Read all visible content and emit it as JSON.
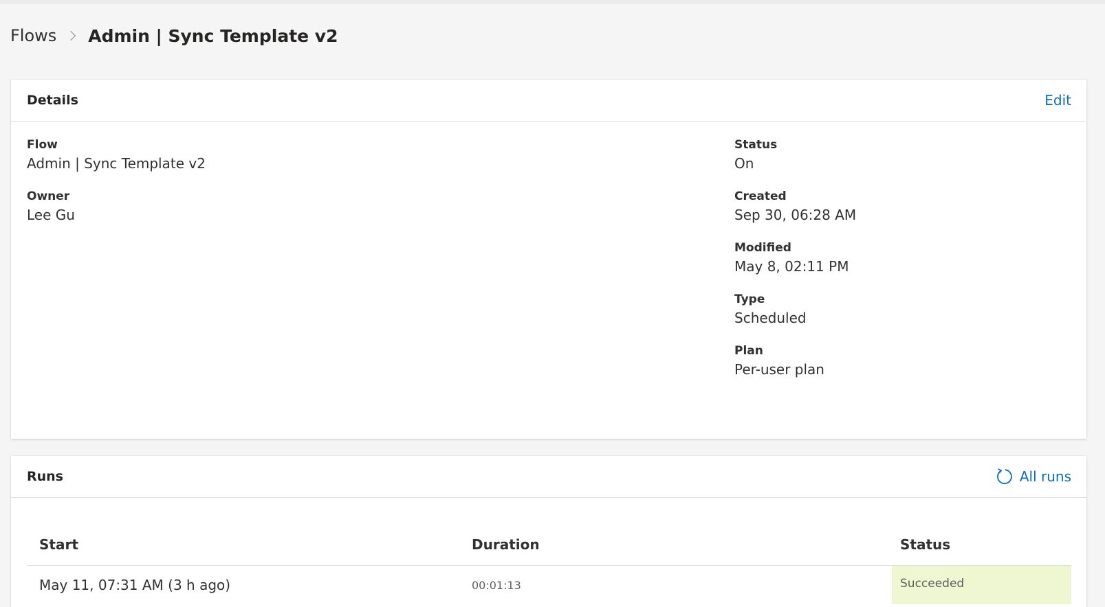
{
  "breadcrumb": {
    "root": "Flows",
    "current": "Admin | Sync Template v2"
  },
  "details": {
    "title": "Details",
    "edit_label": "Edit",
    "left_fields": [
      {
        "label": "Flow",
        "value": "Admin | Sync Template v2"
      },
      {
        "label": "Owner",
        "value": "Lee Gu"
      }
    ],
    "right_fields": [
      {
        "label": "Status",
        "value": "On"
      },
      {
        "label": "Created",
        "value": "Sep 30, 06:28 AM"
      },
      {
        "label": "Modified",
        "value": "May 8, 02:11 PM"
      },
      {
        "label": "Type",
        "value": "Scheduled"
      },
      {
        "label": "Plan",
        "value": "Per-user plan"
      }
    ]
  },
  "runs": {
    "title": "Runs",
    "all_runs_label": "All runs",
    "all_runs_icon": "refresh-icon",
    "columns": [
      "Start",
      "Duration",
      "Status"
    ],
    "rows": [
      {
        "start": "May 11, 07:31 AM (3 h ago)",
        "duration": "00:01:13",
        "status": "Succeeded"
      }
    ]
  },
  "colors": {
    "accent": "#0f6cbd",
    "succeeded_bg": "#eff6d2",
    "page_bg": "#f5f5f5"
  }
}
